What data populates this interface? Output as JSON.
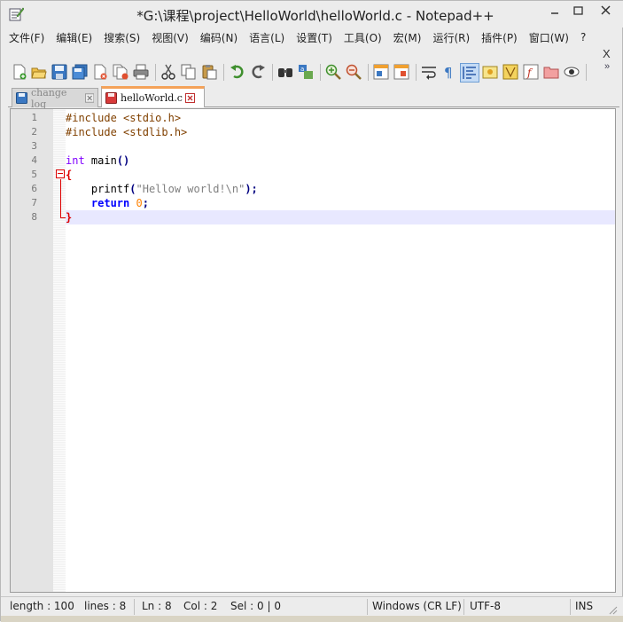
{
  "window": {
    "title": "*G:\\课程\\project\\HelloWorld\\helloWorld.c - Notepad++"
  },
  "menu": {
    "items": [
      "文件(F)",
      "编辑(E)",
      "搜索(S)",
      "视图(V)",
      "编码(N)",
      "语言(L)",
      "设置(T)",
      "工具(O)",
      "宏(M)",
      "运行(R)",
      "插件(P)",
      "窗口(W)",
      "?"
    ],
    "close_label": "X"
  },
  "toolbar": {
    "buttons": [
      "new-file",
      "open-file",
      "save",
      "save-all",
      "close",
      "close-all",
      "print",
      "cut",
      "copy",
      "paste",
      "undo",
      "redo",
      "find",
      "replace",
      "zoom-in",
      "zoom-out",
      "sync-vertical",
      "sync-horizontal",
      "word-wrap",
      "show-all-characters",
      "indent-guide",
      "user-defined-language",
      "document-map",
      "function-list",
      "folder-as-workspace",
      "monitoring"
    ],
    "overflow": "»"
  },
  "tabs": [
    {
      "label": "change log",
      "active": false
    },
    {
      "label": "helloWorld.c",
      "active": true
    }
  ],
  "editor": {
    "line_numbers": [
      "1",
      "2",
      "3",
      "4",
      "5",
      "6",
      "7",
      "8"
    ],
    "lines": {
      "l1": "#include <stdio.h>",
      "l2": "#include <stdlib.h>",
      "l4_type": "int",
      "l4_name": " main",
      "l4_paren": "()",
      "l5": "{",
      "l6_fn": "printf",
      "l6_open": "(",
      "l6_str": "\"Hellow world!\\n\"",
      "l6_close": ");",
      "l7_kw": "return",
      "l7_num": "0",
      "l7_semi": ";",
      "l8": "}"
    }
  },
  "status": {
    "length": "length : 100",
    "lines": "lines : 8",
    "ln": "Ln : 8",
    "col": "Col : 2",
    "sel": "Sel : 0 | 0",
    "eol": "Windows (CR LF)",
    "encoding": "UTF-8",
    "mode": "INS"
  }
}
